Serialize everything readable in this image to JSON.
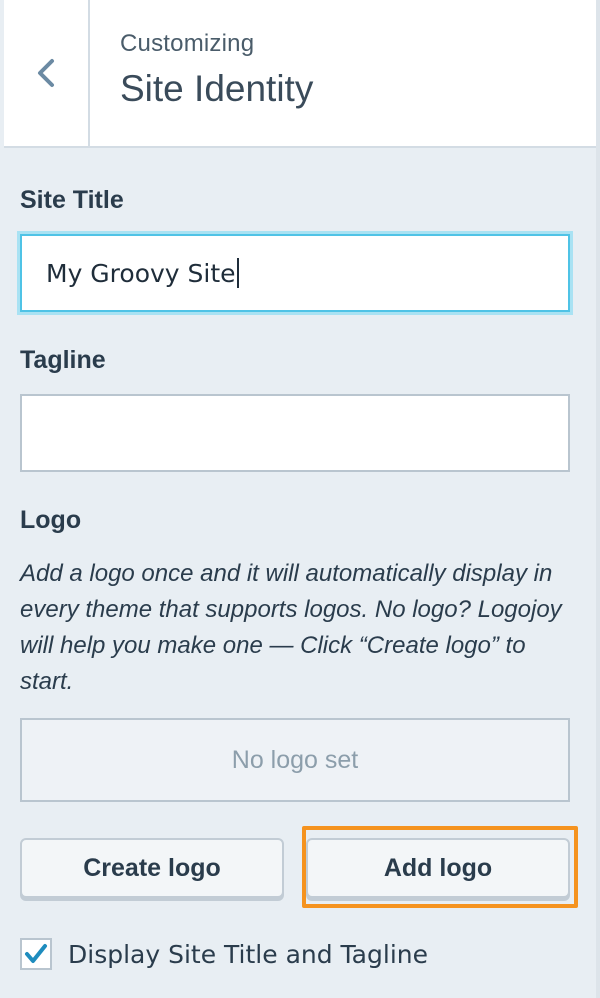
{
  "header": {
    "subtitle": "Customizing",
    "title": "Site Identity"
  },
  "site_title": {
    "label": "Site Title",
    "value": "My Groovy Site"
  },
  "tagline": {
    "label": "Tagline",
    "value": ""
  },
  "logo": {
    "label": "Logo",
    "description": "Add a logo once and it will automatically display in every theme that supports logos. No logo? Logojoy will help you make one — Click “Create logo” to start.",
    "empty_text": "No logo set",
    "create_button": "Create logo",
    "add_button": "Add logo"
  },
  "display_title_tagline": {
    "label": "Display Site Title and Tagline",
    "checked": true
  },
  "colors": {
    "highlight": "#f5931f",
    "focus": "#4fc3e6",
    "check": "#1e8cbe"
  }
}
